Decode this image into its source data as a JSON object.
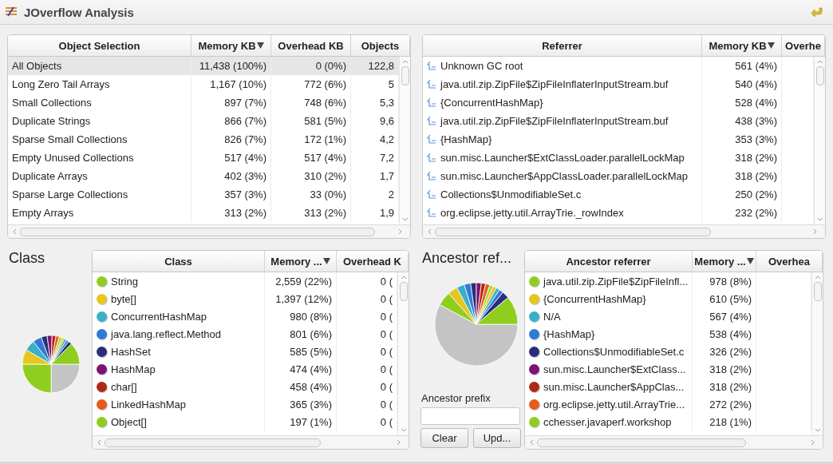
{
  "window": {
    "title": "JOverflow Analysis"
  },
  "object_selection": {
    "columns": [
      {
        "label": "Object Selection",
        "sorted": false
      },
      {
        "label": "Memory KB",
        "sorted": true
      },
      {
        "label": "Overhead KB",
        "sorted": false
      },
      {
        "label": "Objects",
        "sorted": false
      }
    ],
    "rows": [
      {
        "selected": true,
        "cells": [
          "All Objects",
          "11,438 (100%)",
          "0 (0%)",
          "122,8"
        ]
      },
      {
        "selected": false,
        "cells": [
          "Long Zero Tail Arrays",
          "1,167 (10%)",
          "772 (6%)",
          "5"
        ]
      },
      {
        "selected": false,
        "cells": [
          "Small Collections",
          "897 (7%)",
          "748 (6%)",
          "5,3"
        ]
      },
      {
        "selected": false,
        "cells": [
          "Duplicate Strings",
          "866 (7%)",
          "581 (5%)",
          "9,6"
        ]
      },
      {
        "selected": false,
        "cells": [
          "Sparse Small Collections",
          "826 (7%)",
          "172 (1%)",
          "4,2"
        ]
      },
      {
        "selected": false,
        "cells": [
          "Empty Unused Collections",
          "517 (4%)",
          "517 (4%)",
          "7,2"
        ]
      },
      {
        "selected": false,
        "cells": [
          "Duplicate Arrays",
          "402 (3%)",
          "310 (2%)",
          "1,7"
        ]
      },
      {
        "selected": false,
        "cells": [
          "Sparse Large Collections",
          "357 (3%)",
          "33 (0%)",
          "2"
        ]
      },
      {
        "selected": false,
        "cells": [
          "Empty Arrays",
          "313 (2%)",
          "313 (2%)",
          "1,9"
        ]
      }
    ]
  },
  "referrers": {
    "columns": [
      {
        "label": "Referrer",
        "sorted": false
      },
      {
        "label": "Memory KB",
        "sorted": true
      },
      {
        "label": "Overhe",
        "sorted": false
      }
    ],
    "rows": [
      {
        "kind": "referrer",
        "cells": [
          "Unknown GC root",
          "561 (4%)"
        ]
      },
      {
        "kind": "referrer",
        "cells": [
          "java.util.zip.ZipFile$ZipFileInflaterInputStream.buf",
          "540 (4%)"
        ]
      },
      {
        "kind": "referrer",
        "cells": [
          "{ConcurrentHashMap}",
          "528 (4%)"
        ]
      },
      {
        "kind": "referrer",
        "cells": [
          "java.util.zip.ZipFile$ZipFileInflaterInputStream.buf",
          "438 (3%)"
        ]
      },
      {
        "kind": "referrer",
        "cells": [
          "{HashMap}",
          "353 (3%)"
        ]
      },
      {
        "kind": "referrer",
        "cells": [
          "sun.misc.Launcher$ExtClassLoader.parallelLockMap",
          "318 (2%)"
        ]
      },
      {
        "kind": "referrer",
        "cells": [
          "sun.misc.Launcher$AppClassLoader.parallelLockMap",
          "318 (2%)"
        ]
      },
      {
        "kind": "referrer",
        "cells": [
          "Collections$UnmodifiableSet.c",
          "250 (2%)"
        ]
      },
      {
        "kind": "referrer",
        "cells": [
          "org.eclipse.jetty.util.ArrayTrie._rowIndex",
          "232 (2%)"
        ]
      }
    ]
  },
  "class_section": {
    "title": "Class",
    "chart": {
      "kind": "picture"
    },
    "table": {
      "columns": [
        {
          "label": "Class",
          "sorted": false
        },
        {
          "label": "Memory ...",
          "sorted": true
        },
        {
          "label": "Overhead K",
          "sorted": false
        }
      ],
      "rows": [
        {
          "kind": "dot",
          "color": "#8fce1e",
          "cells": [
            "String",
            "2,559 (22%)",
            "0 ("
          ]
        },
        {
          "kind": "dot",
          "color": "#e6c620",
          "cells": [
            "byte[]",
            "1,397 (12%)",
            "0 ("
          ]
        },
        {
          "kind": "dot",
          "color": "#3aafc9",
          "cells": [
            "ConcurrentHashMap",
            "980 (8%)",
            "0 ("
          ]
        },
        {
          "kind": "dot",
          "color": "#2e7bd6",
          "cells": [
            "java.lang.reflect.Method",
            "801 (6%)",
            "0 ("
          ]
        },
        {
          "kind": "dot",
          "color": "#2a2e7a",
          "cells": [
            "HashSet",
            "585 (5%)",
            "0 ("
          ]
        },
        {
          "kind": "dot",
          "color": "#7e1270",
          "cells": [
            "HashMap",
            "474 (4%)",
            "0 ("
          ]
        },
        {
          "kind": "dot",
          "color": "#b0281a",
          "cells": [
            "char[]",
            "458 (4%)",
            "0 ("
          ]
        },
        {
          "kind": "dot",
          "color": "#e85a1c",
          "cells": [
            "LinkedHashMap",
            "365 (3%)",
            "0 ("
          ]
        },
        {
          "kind": "dot",
          "color": "#8fce1e",
          "cells": [
            "Object[]",
            "197 (1%)",
            "0 ("
          ]
        }
      ]
    }
  },
  "ancestor_section": {
    "title": "Ancestor ref...",
    "chart": {
      "kind": "picture"
    },
    "prefix_label": "Ancestor prefix",
    "buttons": [
      "Clear",
      "Upd..."
    ],
    "table": {
      "columns": [
        {
          "label": "Ancestor referrer",
          "sorted": false
        },
        {
          "label": "Memory ...",
          "sorted": true
        },
        {
          "label": "Overhea",
          "sorted": false
        }
      ],
      "rows": [
        {
          "kind": "dot",
          "color": "#8fce1e",
          "cells": [
            "java.util.zip.ZipFile$ZipFileInfl...",
            "978 (8%)"
          ]
        },
        {
          "kind": "dot",
          "color": "#e6c620",
          "cells": [
            "{ConcurrentHashMap}",
            "610 (5%)"
          ]
        },
        {
          "kind": "dot",
          "color": "#3aafc9",
          "cells": [
            "N/A",
            "567 (4%)"
          ]
        },
        {
          "kind": "dot",
          "color": "#2e7bd6",
          "cells": [
            "{HashMap}",
            "538 (4%)"
          ]
        },
        {
          "kind": "dot",
          "color": "#2a2e7a",
          "cells": [
            "Collections$UnmodifiableSet.c",
            "326 (2%)"
          ]
        },
        {
          "kind": "dot",
          "color": "#7e1270",
          "cells": [
            "sun.misc.Launcher$ExtClass...",
            "318 (2%)"
          ]
        },
        {
          "kind": "dot",
          "color": "#b0281a",
          "cells": [
            "sun.misc.Launcher$AppClas...",
            "318 (2%)"
          ]
        },
        {
          "kind": "dot",
          "color": "#e85a1c",
          "cells": [
            "org.eclipse.jetty.util.ArrayTrie...",
            "272 (2%)"
          ]
        },
        {
          "kind": "dot",
          "color": "#8fce1e",
          "cells": [
            "cchesser.javaperf.workshop",
            "218 (1%)"
          ]
        }
      ]
    }
  }
}
